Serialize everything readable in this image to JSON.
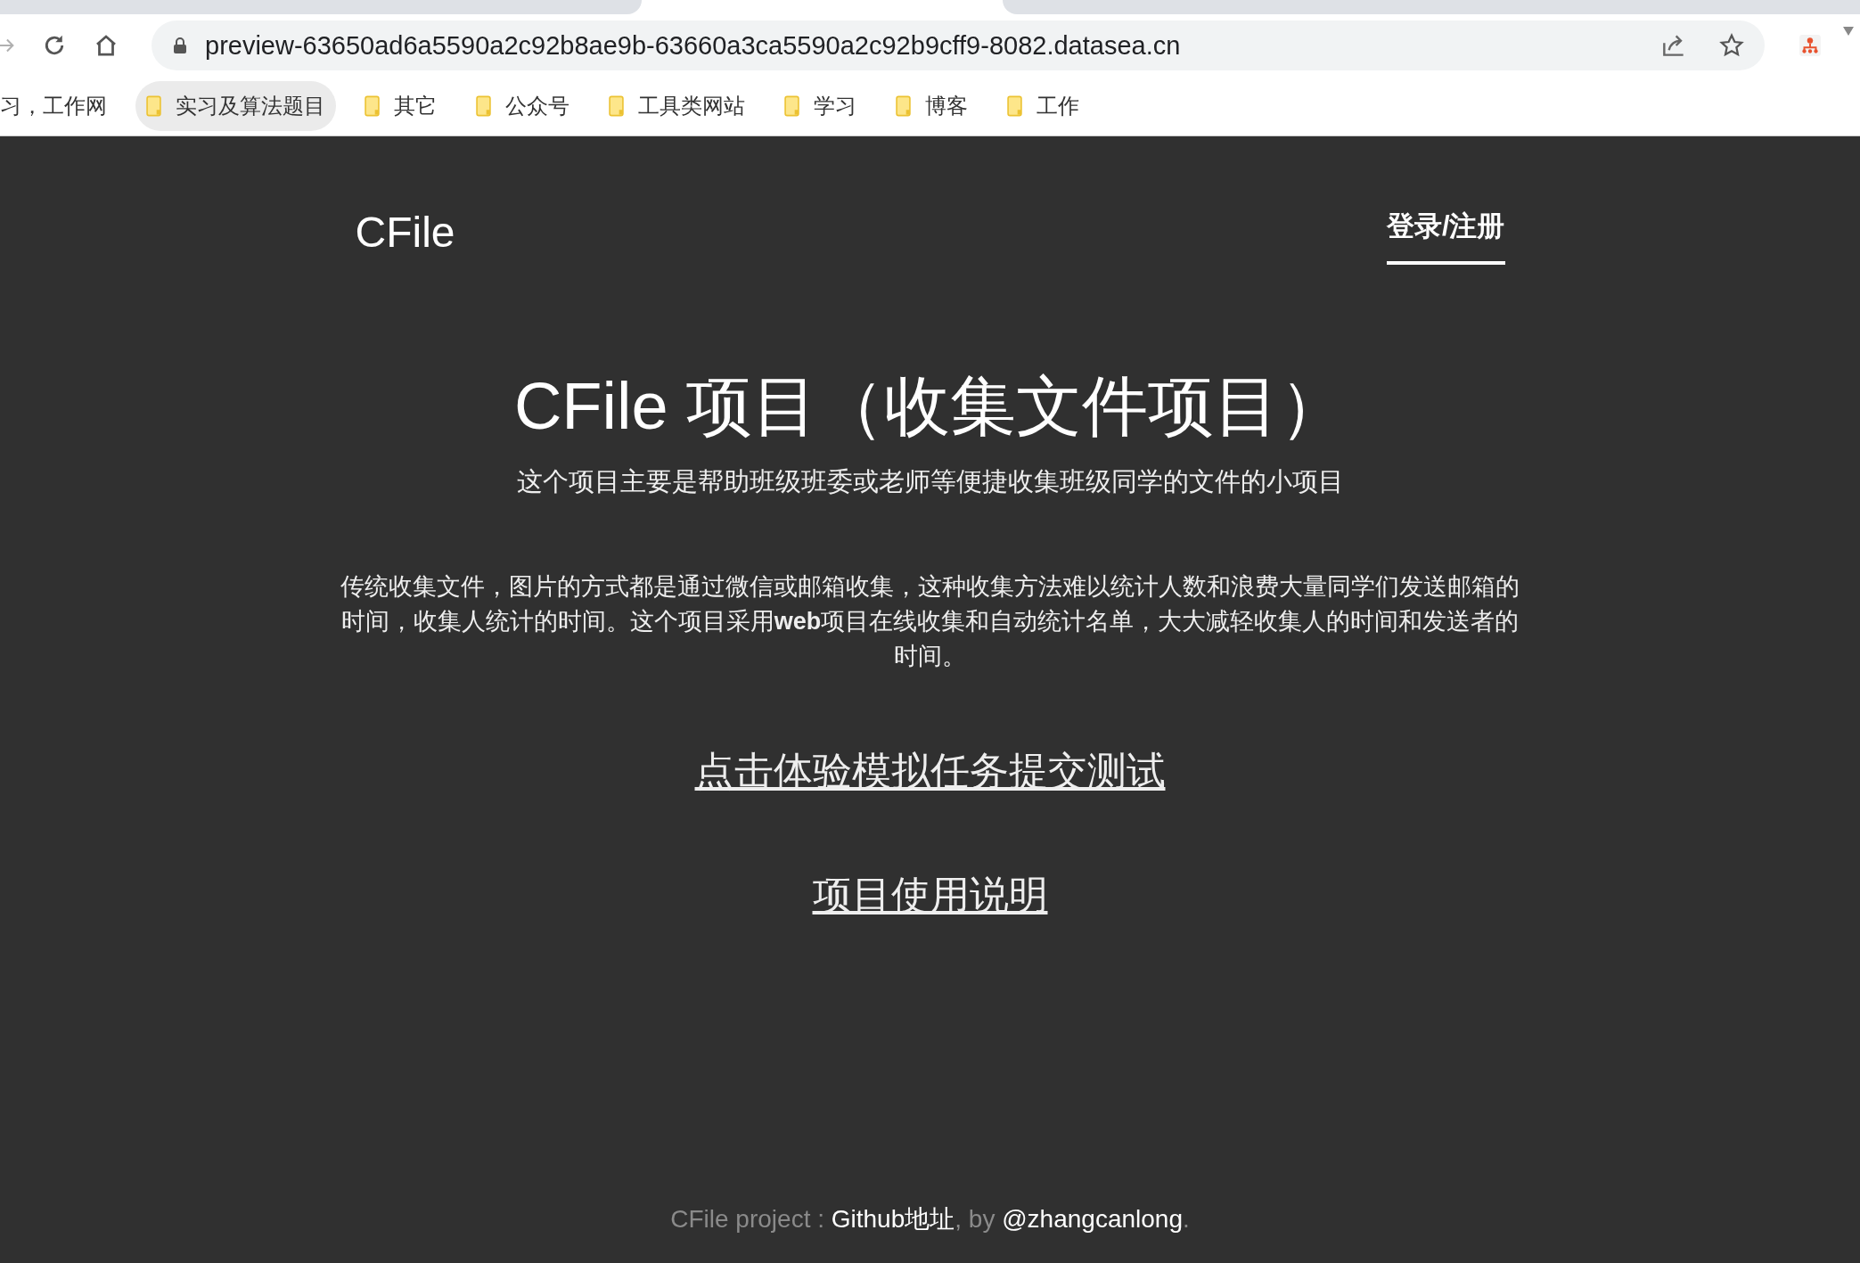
{
  "browser": {
    "url": "preview-63650ad6a5590a2c92b8ae9b-63660a3ca5590a2c92b9cff9-8082.datasea.cn"
  },
  "bookmarks": [
    {
      "label": "习，工作网",
      "kind": "partial",
      "selected": false
    },
    {
      "label": "实习及算法题目",
      "kind": "folder",
      "selected": true
    },
    {
      "label": "其它",
      "kind": "folder",
      "selected": false
    },
    {
      "label": "公众号",
      "kind": "folder",
      "selected": false
    },
    {
      "label": "工具类网站",
      "kind": "folder",
      "selected": false
    },
    {
      "label": "学习",
      "kind": "folder",
      "selected": false
    },
    {
      "label": "博客",
      "kind": "folder",
      "selected": false
    },
    {
      "label": "工作",
      "kind": "folder",
      "selected": false
    }
  ],
  "nav": {
    "brand": "CFile",
    "login": "登录/注册"
  },
  "hero": {
    "title": "CFile 项目（收集文件项目）",
    "subtitle": "这个项目主要是帮助班级班委或老师等便捷收集班级同学的文件的小项目",
    "description": "传统收集文件，图片的方式都是通过微信或邮箱收集，这种收集方法难以统计人数和浪费大量同学们发送邮箱的时间，收集人统计的时间。这个项目采用**web**项目在线收集和自动统计名单，大大减轻收集人的时间和发送者的时间。",
    "links": [
      "点击体验模拟任务提交测试",
      "项目使用说明"
    ]
  },
  "footer": {
    "prefix": "CFile project : ",
    "github_link": "Github地址",
    "middle": ", by ",
    "author_link": "@zhangcanlong",
    "suffix": "."
  }
}
